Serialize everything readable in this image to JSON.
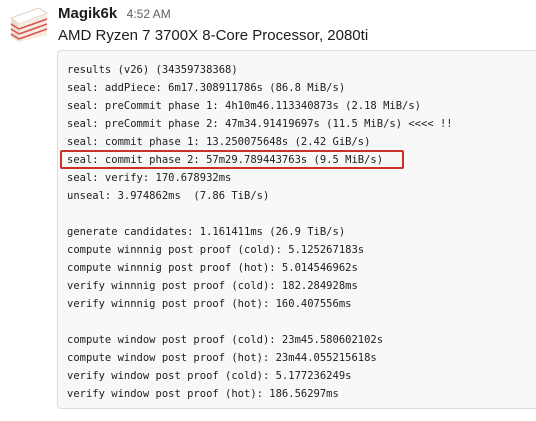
{
  "message": {
    "username": "Magik6k",
    "timestamp": "4:52 AM",
    "subtitle": "AMD Ryzen 7 3700X 8-Core Processor, 2080ti",
    "avatar_icon": "cake-slice-icon",
    "highlight_color": "#c8322a",
    "code_lines": [
      "results (v26) (34359738368)",
      "seal: addPiece: 6m17.308911786s (86.8 MiB/s)",
      "seal: preCommit phase 1: 4h10m46.113340873s (2.18 MiB/s)",
      "seal: preCommit phase 2: 47m34.91419697s (11.5 MiB/s) <<<< !!",
      "seal: commit phase 1: 13.250075648s (2.42 GiB/s)",
      "seal: commit phase 2: 57m29.789443763s (9.5 MiB/s)",
      "seal: verify: 170.678932ms",
      "unseal: 3.974862ms  (7.86 TiB/s)",
      "",
      "generate candidates: 1.161411ms (26.9 TiB/s)",
      "compute winnnig post proof (cold): 5.125267183s",
      "compute winnnig post proof (hot): 5.014546962s",
      "verify winnnig post proof (cold): 182.284928ms",
      "verify winnnig post proof (hot): 160.407556ms",
      "",
      "compute window post proof (cold): 23m45.580602102s",
      "compute window post proof (hot): 23m44.055215618s",
      "verify window post proof (cold): 5.177236249s",
      "verify window post proof (hot): 186.56297ms"
    ]
  }
}
